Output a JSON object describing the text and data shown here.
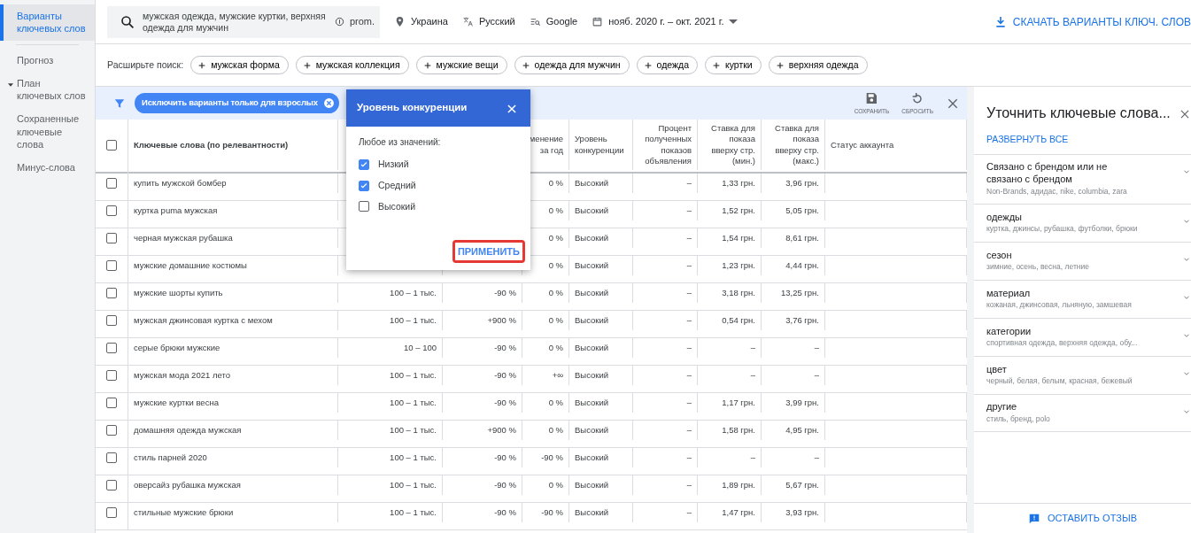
{
  "sidebar": {
    "items": [
      {
        "label": "Варианты ключевых слов",
        "selected": true,
        "kind": "link"
      },
      {
        "label": "Прогноз",
        "selected": false,
        "kind": "link"
      },
      {
        "label": "План ключевых слов",
        "selected": false,
        "kind": "group"
      },
      {
        "label": "Сохраненные ключевые слова",
        "selected": false,
        "kind": "link"
      },
      {
        "label": "Минус-слова",
        "selected": false,
        "kind": "link"
      }
    ]
  },
  "top_bar": {
    "query": "мужская одежда, мужские куртки, верхняя одежда для мужчин",
    "site": "prom.",
    "location": "Украина",
    "language": "Русский",
    "network": "Google",
    "date_range": "нояб. 2020 г. – окт. 2021 г.",
    "download": "СКАЧАТЬ ВАРИАНТЫ КЛЮЧ. СЛОВ"
  },
  "expand_search": {
    "label": "Расширьте поиск:",
    "chips": [
      "мужская форма",
      "мужская коллекция",
      "мужские вещи",
      "одежда для мужчин",
      "одежда",
      "куртки",
      "верхняя одежда"
    ]
  },
  "filter_bar": {
    "filter": "Исключить варианты только для взрослых",
    "save": "СОХРАНИТЬ",
    "reset": "СБРОСИТЬ"
  },
  "table": {
    "select_all_checked": false,
    "columns": [
      {
        "kind": "text",
        "header": "Ключевые слова (по релевантности)"
      },
      {
        "kind": "number"
      },
      {
        "kind": "number"
      },
      {
        "kind": "number",
        "header": "менение за год"
      },
      {
        "kind": "text",
        "header": "Уровень конкуренции"
      },
      {
        "kind": "number",
        "header": "Процент полученных показов объявления"
      },
      {
        "kind": "number",
        "header": "Ставка для показа вверху стр. (мин.)"
      },
      {
        "kind": "number",
        "header": "Ставка для показа вверху стр. (макс.)"
      },
      {
        "kind": "text",
        "header": "Статус аккаунта"
      }
    ],
    "rows": [
      {
        "checked": false,
        "cells": [
          "купить мужской бомбер",
          null,
          null,
          "0 %",
          "Высокий",
          "–",
          "1,33 грн.",
          "3,96 грн."
        ]
      },
      {
        "checked": false,
        "cells": [
          "куртка puma мужская",
          null,
          null,
          "0 %",
          "Высокий",
          "–",
          "1,52 грн.",
          "5,05 грн."
        ]
      },
      {
        "checked": false,
        "cells": [
          "черная мужская рубашка",
          null,
          null,
          "0 %",
          "Высокий",
          "–",
          "1,54 грн.",
          "8,61 грн."
        ]
      },
      {
        "checked": false,
        "cells": [
          "мужские домашние костюмы",
          null,
          null,
          "0 %",
          "Высокий",
          "–",
          "1,23 грн.",
          "4,44 грн."
        ]
      },
      {
        "checked": false,
        "cells": [
          "мужские шорты купить",
          "100 – 1 тыс.",
          "-90 %",
          "0 %",
          "Высокий",
          "–",
          "3,18 грн.",
          "13,25 грн."
        ]
      },
      {
        "checked": false,
        "cells": [
          "мужская джинсовая куртка с мехом",
          "100 – 1 тыс.",
          "+900 %",
          "0 %",
          "Высокий",
          "–",
          "0,54 грн.",
          "3,76 грн."
        ]
      },
      {
        "checked": false,
        "cells": [
          "серые брюки мужские",
          "10 – 100",
          "-90 %",
          "0 %",
          "Высокий",
          "–",
          "–",
          "–"
        ]
      },
      {
        "checked": false,
        "cells": [
          "мужская мода 2021 лето",
          "100 – 1 тыс.",
          "-90 %",
          "+∞",
          "Высокий",
          "–",
          "–",
          "–"
        ]
      },
      {
        "checked": false,
        "cells": [
          "мужские куртки весна",
          "100 – 1 тыс.",
          "-90 %",
          "0 %",
          "Высокий",
          "–",
          "1,17 грн.",
          "3,99 грн."
        ]
      },
      {
        "checked": false,
        "cells": [
          "домашняя одежда мужская",
          "100 – 1 тыс.",
          "+900 %",
          "0 %",
          "Высокий",
          "–",
          "1,58 грн.",
          "4,95 грн."
        ]
      },
      {
        "checked": false,
        "cells": [
          "стиль парней 2020",
          "100 – 1 тыс.",
          "-90 %",
          "-90 %",
          "Высокий",
          "–",
          "–",
          "–"
        ]
      },
      {
        "checked": false,
        "cells": [
          "оверсайз рубашка мужская",
          "100 – 1 тыс.",
          "-90 %",
          "0 %",
          "Высокий",
          "–",
          "1,89 грн.",
          "5,67 грн."
        ]
      },
      {
        "checked": false,
        "cells": [
          "стильные мужские брюки",
          "100 – 1 тыс.",
          "-90 %",
          "-90 %",
          "Высокий",
          "–",
          "1,47 грн.",
          "3,93 грн."
        ]
      }
    ]
  },
  "popup": {
    "title": "Уровень конкуренции",
    "subtitle": "Любое из значений:",
    "options": [
      {
        "label": "Низкий",
        "checked": true
      },
      {
        "label": "Средний",
        "checked": true
      },
      {
        "label": "Высокий",
        "checked": false
      }
    ],
    "apply": "ПРИМЕНИТЬ"
  },
  "refine_panel": {
    "title": "Уточнить ключевые слова...",
    "expand_all": "РАЗВЕРНУТЬ ВСЕ",
    "groups": [
      {
        "title": "Связано с брендом или не связано с брендом",
        "examples": "Non-Brands, адидас, nike, columbia, zara"
      },
      {
        "title": "одежды",
        "examples": "куртка, джинсы, рубашка, футболки, брюки"
      },
      {
        "title": "сезон",
        "examples": "зимние, осень, весна, летние"
      },
      {
        "title": "материал",
        "examples": "кожаная, джинсовая, льняную, замшевая"
      },
      {
        "title": "категории",
        "examples": "спортивная одежда, верхняя одежда, обу..."
      },
      {
        "title": "цвет",
        "examples": "черный, белая, белым, красная, бежевый"
      },
      {
        "title": "другие",
        "examples": "стиль, бренд, polo"
      }
    ],
    "feedback": "ОСТАВИТЬ ОТЗЫВ"
  }
}
